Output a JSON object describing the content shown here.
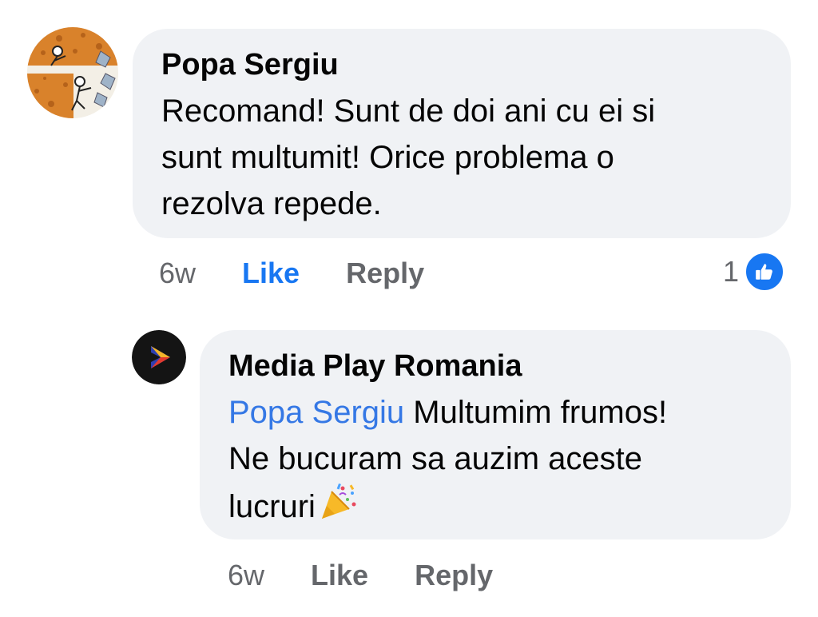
{
  "colors": {
    "bubble_bg": "#f0f2f5",
    "text": "#050505",
    "muted": "#65676b",
    "accent": "#1877f2",
    "mention": "#3578e5"
  },
  "comment": {
    "avatar_icon": "profile-photo-cartoon-miners",
    "author": "Popa Sergiu",
    "lines": [
      "Recomand! Sunt de doi ani cu ei si",
      "sunt multumit! Orice problema o",
      "rezolva repede."
    ],
    "time": "6w",
    "like_label": "Like",
    "like_active": true,
    "reply_label": "Reply",
    "reaction_count": "1",
    "reaction_icon": "like-thumb-icon"
  },
  "reply": {
    "avatar_icon": "media-play-logo",
    "author": "Media Play Romania",
    "mention": "Popa Sergiu",
    "line1_rest": " Multumim frumos!",
    "line2": "Ne bucuram sa auzim aceste",
    "line3": "lucruri",
    "emoji_icon": "party-popper-icon",
    "time": "6w",
    "like_label": "Like",
    "reply_label": "Reply"
  }
}
